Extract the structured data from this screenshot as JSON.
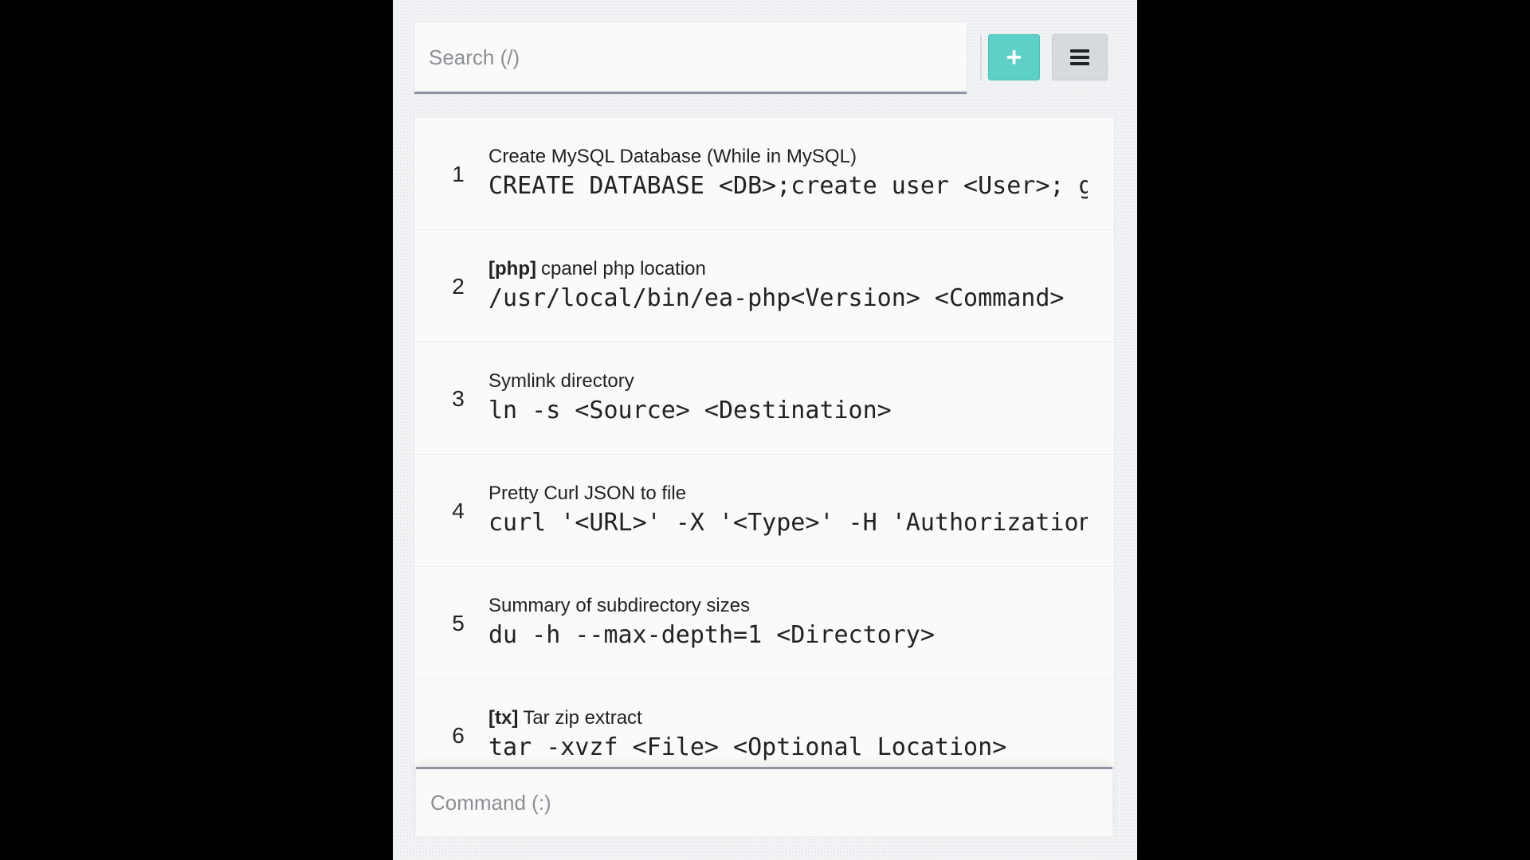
{
  "search": {
    "placeholder": "Search (/)",
    "value": ""
  },
  "toolbar": {
    "add_icon": "plus-icon",
    "add_glyph": "+",
    "menu_icon": "hamburger-menu-icon"
  },
  "snippets": [
    {
      "number": "1",
      "tag": "",
      "title": "Create MySQL Database (While in MySQL)",
      "command": "CREATE DATABASE <DB>;create user <User>; g"
    },
    {
      "number": "2",
      "tag": "[php]",
      "title": "cpanel php location",
      "command": "/usr/local/bin/ea-php<Version> <Command>"
    },
    {
      "number": "3",
      "tag": "",
      "title": "Symlink directory",
      "command": "ln -s <Source> <Destination>"
    },
    {
      "number": "4",
      "tag": "",
      "title": "Pretty Curl JSON to file",
      "command": "curl '<URL>' -X '<Type>' -H 'Authorization"
    },
    {
      "number": "5",
      "tag": "",
      "title": "Summary of subdirectory sizes",
      "command": "du -h --max-depth=1 <Directory>"
    },
    {
      "number": "6",
      "tag": "[tx]",
      "title": "Tar zip extract",
      "command": "tar -xvzf <File> <Optional Location>"
    }
  ],
  "command_bar": {
    "placeholder": "Command (:)",
    "value": ""
  },
  "colors": {
    "add_button": "#5ed1c6",
    "menu_button": "#d5dade",
    "background": "#f1f3f5",
    "letterbox": "#000000"
  }
}
